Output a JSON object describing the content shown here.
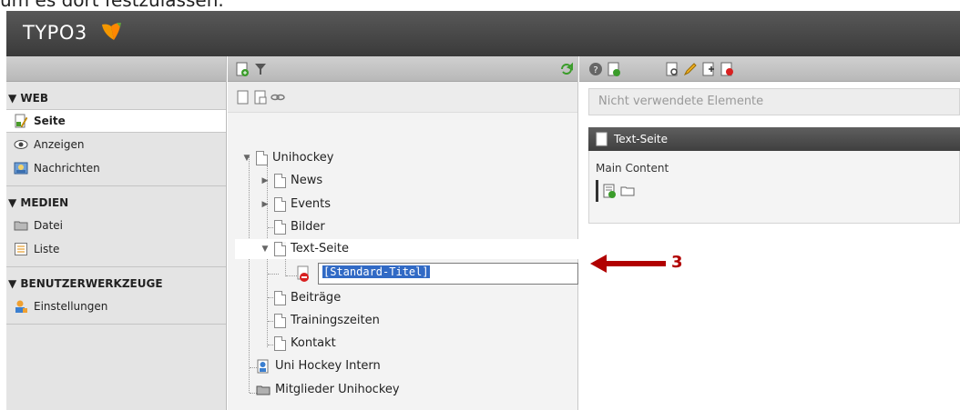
{
  "top_text": "um es dort festzulassen.",
  "topbar": {
    "logo": "TYPO3"
  },
  "module_menu": {
    "sections": [
      {
        "title": "▼ WEB",
        "items": [
          {
            "label": "Seite",
            "icon": "page-module-icon",
            "active": true
          },
          {
            "label": "Anzeigen",
            "icon": "eye-icon",
            "active": false
          },
          {
            "label": "Nachrichten",
            "icon": "news-icon",
            "active": false
          }
        ]
      },
      {
        "title": "▼ MEDIEN",
        "items": [
          {
            "label": "Datei",
            "icon": "folder-icon",
            "active": false
          },
          {
            "label": "Liste",
            "icon": "list-icon",
            "active": false
          }
        ]
      },
      {
        "title": "▼ BENUTZERWERKZEUGE",
        "items": [
          {
            "label": "Einstellungen",
            "icon": "user-settings-icon",
            "active": false
          }
        ]
      }
    ]
  },
  "tree": {
    "nodes": [
      {
        "label": "Unihockey"
      },
      {
        "label": "News"
      },
      {
        "label": "Events"
      },
      {
        "label": "Bilder"
      },
      {
        "label": "Text-Seite"
      },
      {
        "label": "Beiträge"
      },
      {
        "label": "Trainingszeiten"
      },
      {
        "label": "Kontakt"
      },
      {
        "label": "Uni Hockey Intern"
      },
      {
        "label": "Mitglieder Unihockey"
      }
    ],
    "edit_value": "[Standard-Titel]"
  },
  "content": {
    "unused_elements": "Nicht verwendete Elemente",
    "column_title": "Text-Seite",
    "column_label": "Main Content"
  },
  "annotation": {
    "number": "3",
    "color": "#b10000"
  },
  "colors": {
    "topbar": "#484848",
    "accent_orange": "#f49700",
    "selection": "#316ac5"
  }
}
